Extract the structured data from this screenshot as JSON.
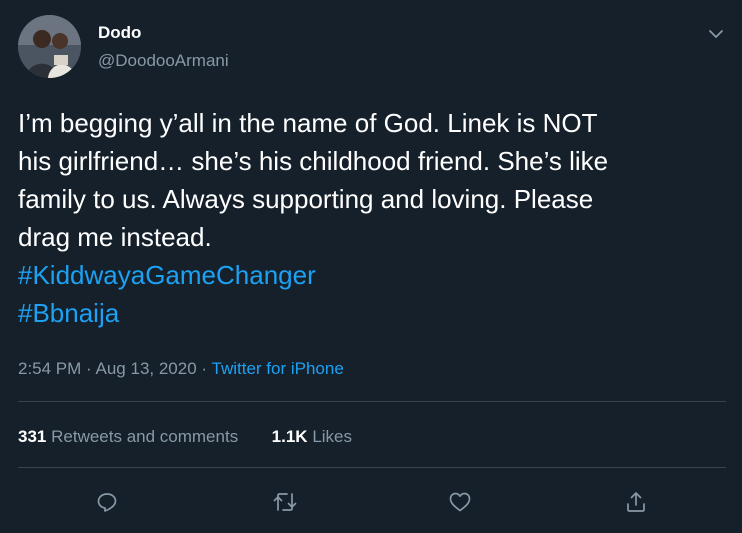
{
  "author": {
    "display_name": "Dodo",
    "handle": "@DoodooArmani"
  },
  "tweet": {
    "lines": [
      "I’m begging y’all in the name of God. Linek is NOT",
      "his girlfriend… she’s his childhood friend. She’s like",
      "family to us. Always supporting and loving. Please",
      "drag me instead."
    ],
    "hashtags": [
      "#KiddwayaGameChanger",
      "#Bbnaija"
    ]
  },
  "meta": {
    "time": "2:54 PM",
    "separator": "·",
    "date": "Aug 13, 2020",
    "source": "Twitter for iPhone"
  },
  "stats": {
    "retweets_count": "331",
    "retweets_label": "Retweets and comments",
    "likes_count": "1.1K",
    "likes_label": "Likes"
  },
  "icons": {
    "more": "chevron-down-icon",
    "reply": "reply-icon",
    "retweet": "retweet-icon",
    "like": "heart-icon",
    "share": "share-icon"
  },
  "colors": {
    "background": "#15202b",
    "text": "#ffffff",
    "secondary": "#8899a6",
    "accent": "#1da1f2",
    "divider": "#38444d"
  }
}
